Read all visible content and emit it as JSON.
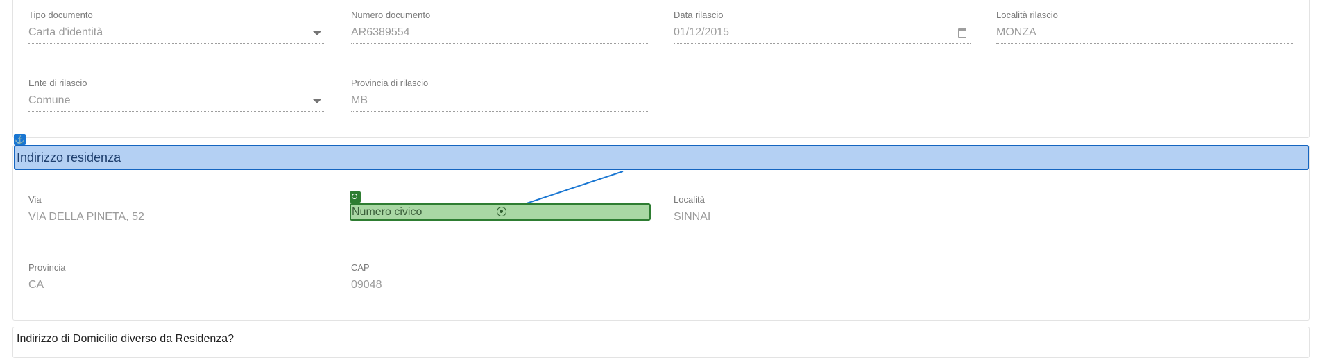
{
  "documento": {
    "tipo": {
      "label": "Tipo documento",
      "value": "Carta d'identità"
    },
    "numero": {
      "label": "Numero documento",
      "value": "AR6389554"
    },
    "data": {
      "label": "Data rilascio",
      "value": "01/12/2015"
    },
    "localita": {
      "label": "Località rilascio",
      "value": "MONZA"
    },
    "ente": {
      "label": "Ente di rilascio",
      "value": "Comune"
    },
    "provincia": {
      "label": "Provincia di rilascio",
      "value": "MB"
    }
  },
  "residenza": {
    "section_title": "Indirizzo residenza",
    "via": {
      "label": "Via",
      "value": "VIA DELLA PINETA, 52"
    },
    "civico": {
      "placeholder": "Numero civico"
    },
    "localita": {
      "label": "Località",
      "value": "SINNAI"
    },
    "provincia": {
      "label": "Provincia",
      "value": "CA"
    },
    "cap": {
      "label": "CAP",
      "value": "09048"
    }
  },
  "domicilio": {
    "question": "Indirizzo di Domicilio diverso da Residenza?"
  },
  "colors": {
    "anchor": "#1976d2",
    "section_highlight": "#b4d0f3",
    "target_highlight": "#a9d8a4",
    "target_border": "#2e7d32"
  },
  "icons": [
    "anchor-icon",
    "target-icon",
    "crosshair-icon",
    "dropdown-caret-icon",
    "calendar-icon"
  ]
}
